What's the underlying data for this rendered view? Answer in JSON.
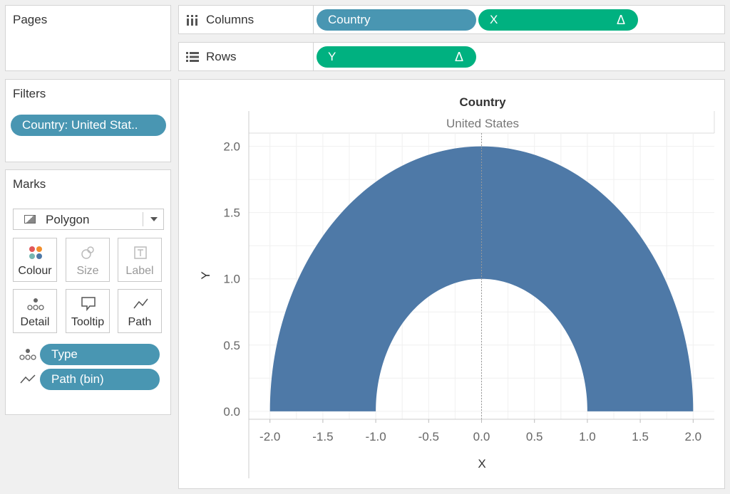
{
  "pages": {
    "title": "Pages"
  },
  "filters": {
    "title": "Filters",
    "pill": "Country: United Stat.."
  },
  "marks": {
    "title": "Marks",
    "type_select": "Polygon",
    "buttons": {
      "colour": "Colour",
      "size": "Size",
      "label": "Label",
      "detail": "Detail",
      "tooltip": "Tooltip",
      "path": "Path"
    },
    "fields": [
      {
        "icon": "detail-icon",
        "label": "Type"
      },
      {
        "icon": "path-icon",
        "label": "Path (bin)"
      }
    ]
  },
  "shelves": {
    "columns": {
      "label": "Columns",
      "pills": [
        {
          "label": "Country",
          "color": "#4996b2"
        },
        {
          "label": "X",
          "delta": "Δ",
          "color": "#00b180"
        }
      ]
    },
    "rows": {
      "label": "Rows",
      "pills": [
        {
          "label": "Y",
          "delta": "Δ",
          "color": "#00b180"
        }
      ]
    }
  },
  "view": {
    "header_title": "Country",
    "header_value": "United States"
  },
  "chart_data": {
    "type": "area",
    "shape": "half-annulus polygon",
    "outer_radius": 2.0,
    "inner_radius": 1.0,
    "xlabel": "X",
    "ylabel": "Y",
    "xlim": [
      -2.2,
      2.2
    ],
    "ylim": [
      -0.06,
      2.1
    ],
    "x_ticks": [
      "-2.0",
      "-1.5",
      "-1.0",
      "-0.5",
      "0.0",
      "0.5",
      "1.0",
      "1.5",
      "2.0"
    ],
    "y_ticks": [
      "0.0",
      "0.5",
      "1.0",
      "1.5",
      "2.0"
    ],
    "fill_color": "#4e79a7",
    "grid": true
  }
}
